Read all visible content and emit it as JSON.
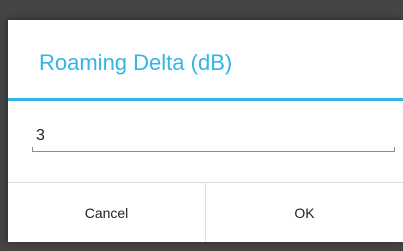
{
  "dialog": {
    "title": "Roaming Delta (dB)",
    "input_value": "3",
    "cancel_label": "Cancel",
    "ok_label": "OK"
  },
  "colors": {
    "accent": "#33b5e5",
    "backdrop": "#444444",
    "dialog_background": "#ffffff",
    "text": "#222222"
  }
}
